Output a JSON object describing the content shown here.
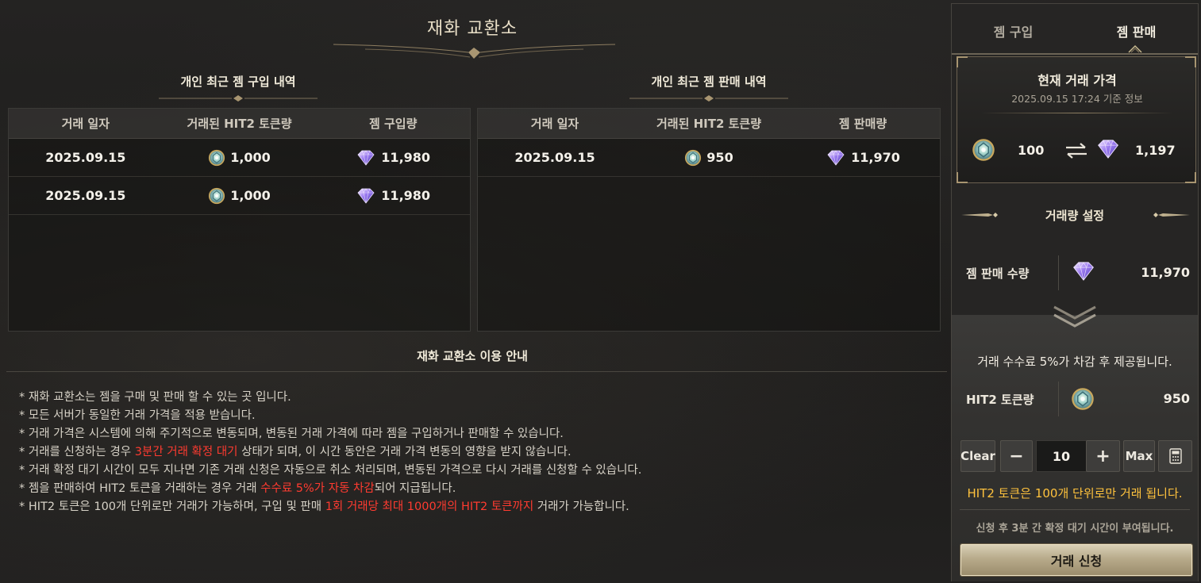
{
  "page": {
    "title": "재화 교환소"
  },
  "buy_history": {
    "title": "개인 최근 젬 구입 내역",
    "columns": [
      "거래 일자",
      "거래된 HIT2 토큰량",
      "젬 구입량"
    ],
    "rows": [
      {
        "date": "2025.09.15",
        "token": "1,000",
        "gem": "11,980"
      },
      {
        "date": "2025.09.15",
        "token": "1,000",
        "gem": "11,980"
      }
    ]
  },
  "sell_history": {
    "title": "개인 최근 젬 판매 내역",
    "columns": [
      "거래 일자",
      "거래된 HIT2 토큰량",
      "젬 판매량"
    ],
    "rows": [
      {
        "date": "2025.09.15",
        "token": "950",
        "gem": "11,970"
      }
    ]
  },
  "guide": {
    "title": "재화 교환소 이용 안내",
    "lines": [
      {
        "prefix": "* 재화 교환소는 젬을 구매 및 판매 할 수 있는 곳 입니다.",
        "highlight": "",
        "suffix": ""
      },
      {
        "prefix": "* 모든 서버가 동일한 거래 가격을 적용 받습니다.",
        "highlight": "",
        "suffix": ""
      },
      {
        "prefix": "* 거래 가격은 시스템에 의해 주기적으로 변동되며, 변동된 거래 가격에 따라 젬을 구입하거나 판매할 수 있습니다.",
        "highlight": "",
        "suffix": ""
      },
      {
        "prefix": "* 거래를 신청하는 경우 ",
        "highlight": "3분간 거래 확정 대기",
        "suffix": " 상태가 되며, 이 시간 동안은 거래 가격 변동의 영향을 받지 않습니다."
      },
      {
        "prefix": "* 거래 확정 대기 시간이 모두 지나면 기존 거래 신청은 자동으로 취소 처리되며, 변동된 가격으로 다시 거래를 신청할 수 있습니다.",
        "highlight": "",
        "suffix": ""
      },
      {
        "prefix": "* 젬을 판매하여 HIT2 토큰을 거래하는 경우 거래 ",
        "highlight": "수수료 5%가 자동 차감",
        "suffix": "되어 지급됩니다."
      },
      {
        "prefix": "* HIT2 토큰은 100개 단위로만 거래가 가능하며, 구입 및 판매 ",
        "highlight": "1회 거래당 최대 1000개의 HIT2 토큰까지",
        "suffix": " 거래가 가능합니다."
      }
    ]
  },
  "panel": {
    "tabs": [
      {
        "label": "젬 구입",
        "active": false
      },
      {
        "label": "젬 판매",
        "active": true
      }
    ],
    "price": {
      "title": "현재 거래 가격",
      "subtitle": "2025.09.15 17:24 기준 정보",
      "token_amount": "100",
      "gem_amount": "1,197"
    },
    "setting": {
      "title": "거래량 설정",
      "qty_label": "젬 판매 수량",
      "qty_value": "11,970"
    },
    "fee_text": "거래 수수료 5%가 차감 후 제공됩니다.",
    "token": {
      "label": "HIT2 토큰량",
      "value": "950"
    },
    "controls": {
      "clear": "Clear",
      "minus": "−",
      "input_value": "10",
      "plus": "+",
      "max": "Max",
      "calculator_icon": "calculator-icon"
    },
    "unit_note": "HIT2 토큰은 100개 단위로만 거래 됩니다.",
    "wait_note": "신청 후 3분 간 확정 대기 시간이 부여됩니다.",
    "submit": "거래 신청"
  },
  "colors": {
    "highlight_red": "#ff3b30",
    "note_yellow": "#ffc23d",
    "gold_accent": "#a89571"
  },
  "icons": {
    "token": "hit2-token-icon",
    "gem": "gem-icon",
    "exchange": "exchange-arrows-icon"
  }
}
